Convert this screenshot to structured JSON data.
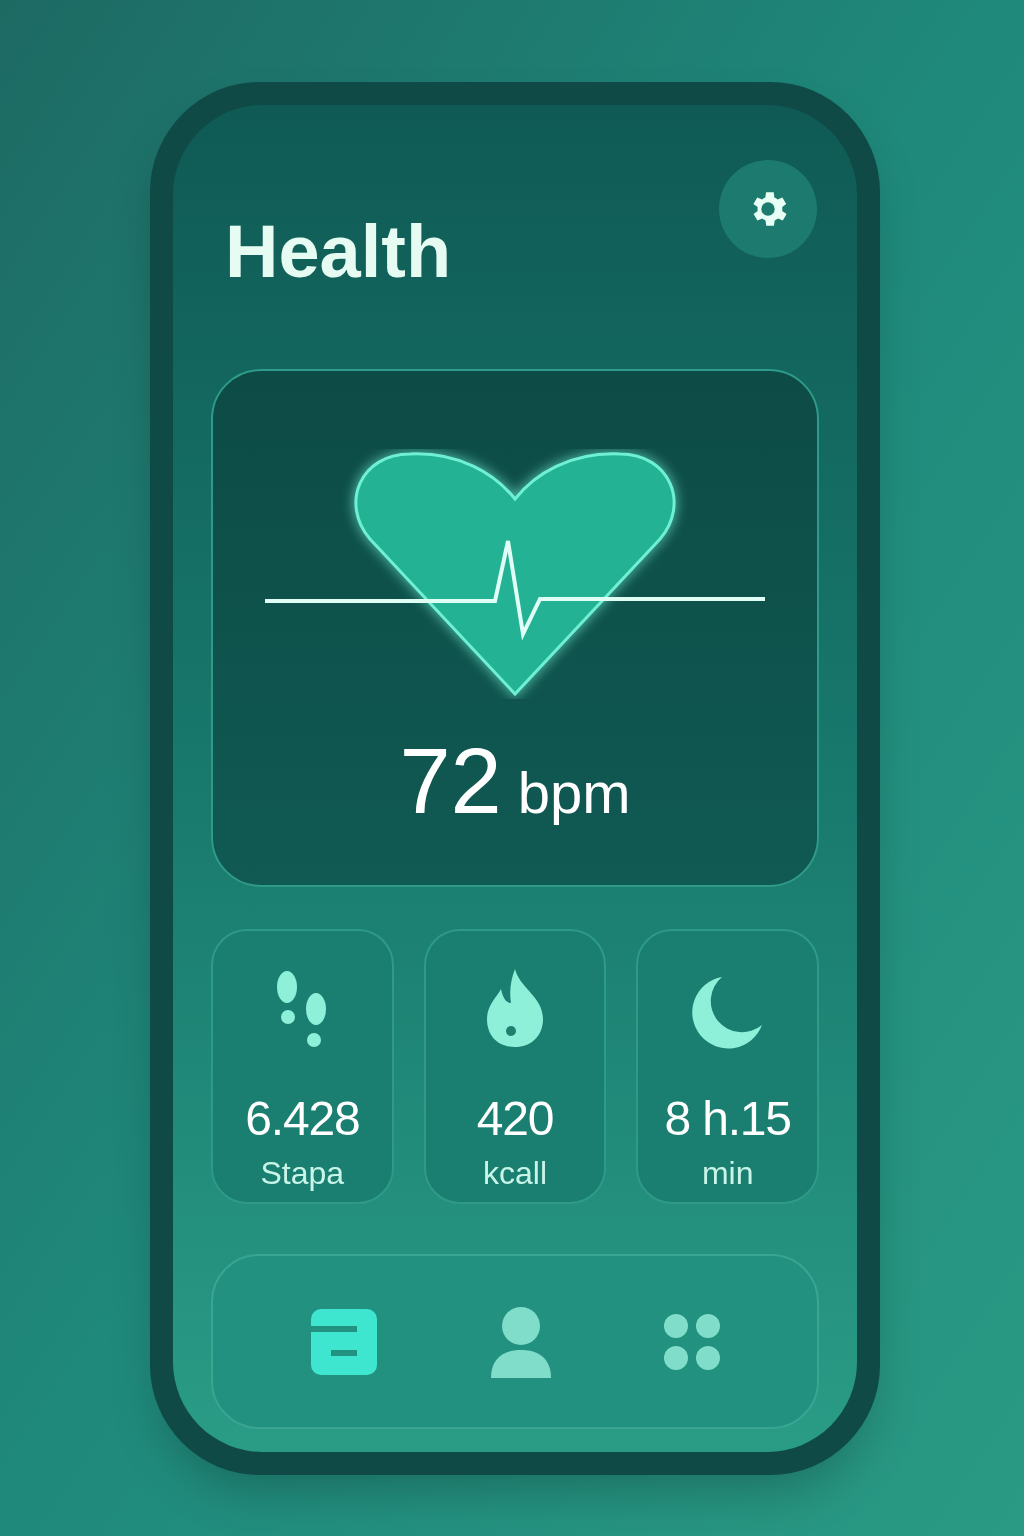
{
  "title": "Health",
  "heart_rate": {
    "value": "72",
    "unit": "bpm"
  },
  "stats": [
    {
      "kind": "steps",
      "value": "6.428",
      "unit": "Stapa"
    },
    {
      "kind": "calories",
      "value": "420",
      "unit": "kcall"
    },
    {
      "kind": "sleep",
      "value": "8 h.15",
      "unit": "min"
    }
  ],
  "nav": [
    {
      "kind": "journal",
      "selected": true
    },
    {
      "kind": "profile",
      "selected": false
    },
    {
      "kind": "apps",
      "selected": false
    }
  ]
}
